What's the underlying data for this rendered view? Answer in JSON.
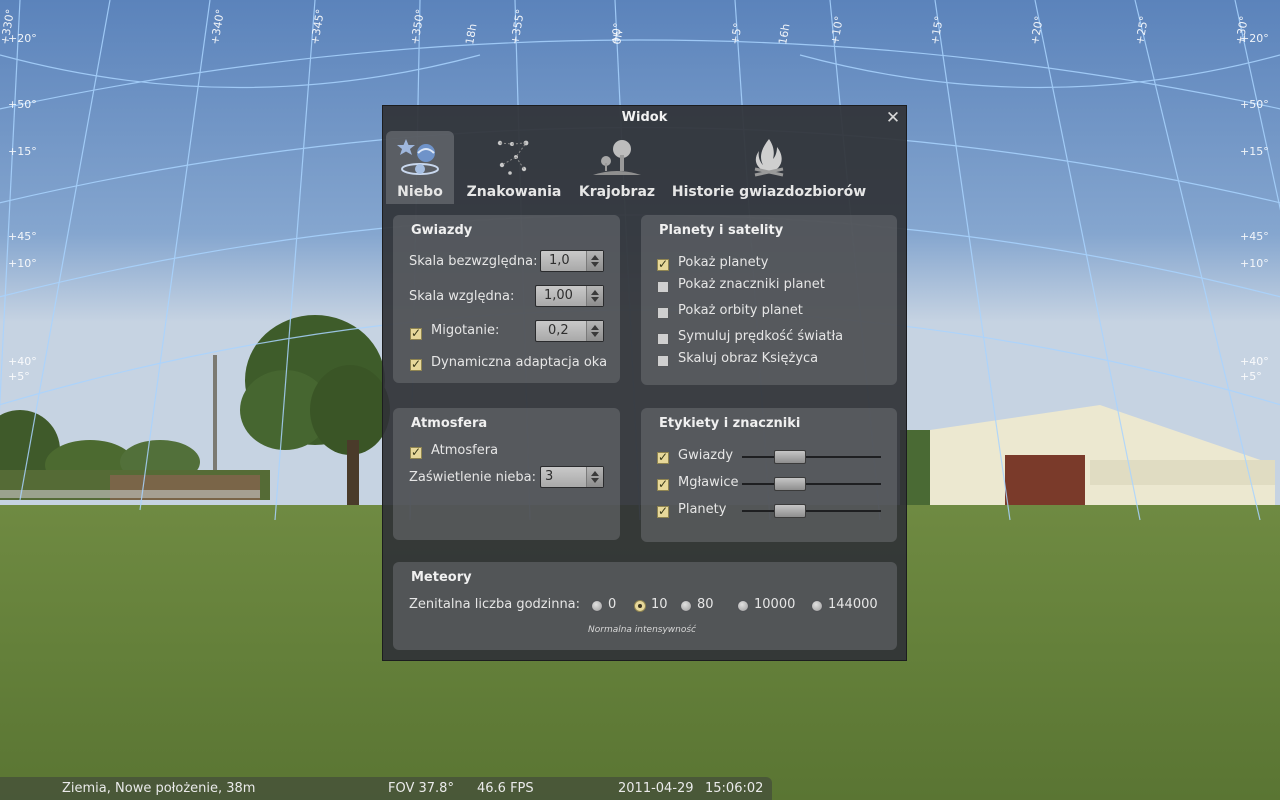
{
  "dialog": {
    "title": "Widok",
    "close_symbol": "✕",
    "tabs": [
      {
        "label": "Niebo",
        "icon": "sky-icon",
        "active": true
      },
      {
        "label": "Znakowania",
        "icon": "constellation-icon",
        "active": false
      },
      {
        "label": "Krajobraz",
        "icon": "landscape-icon",
        "active": false
      },
      {
        "label": "Historie gwiazdozbiorów",
        "icon": "campfire-icon",
        "active": false
      }
    ]
  },
  "stars": {
    "title": "Gwiazdy",
    "absolute_scale_label": "Skala bezwzględna:",
    "absolute_scale_value": "1,0",
    "relative_scale_label": "Skala względna:",
    "relative_scale_value": "1,00",
    "twinkle_label": "Migotanie:",
    "twinkle_checked": true,
    "twinkle_value": "0,2",
    "eye_adaptation_label": "Dynamiczna adaptacja oka",
    "eye_adaptation_checked": true
  },
  "planets": {
    "title": "Planety i satelity",
    "options": [
      {
        "label": "Pokaż planety",
        "checked": true
      },
      {
        "label": "Pokaż znaczniki planet",
        "checked": false
      },
      {
        "label": "Pokaż orbity planet",
        "checked": false
      },
      {
        "label": "Symuluj prędkość światła",
        "checked": false
      },
      {
        "label": "Skaluj obraz Księżyca",
        "checked": false
      }
    ]
  },
  "atmosphere": {
    "title": "Atmosfera",
    "atmosphere_label": "Atmosfera",
    "atmosphere_checked": true,
    "light_pollution_label": "Zaświetlenie nieba:",
    "light_pollution_value": "3"
  },
  "labels": {
    "title": "Etykiety i znaczniki",
    "items": [
      {
        "label": "Gwiazdy",
        "checked": true,
        "level": 0.35
      },
      {
        "label": "Mgławice",
        "checked": true,
        "level": 0.35
      },
      {
        "label": "Planety",
        "checked": true,
        "level": 0.35
      }
    ]
  },
  "meteors": {
    "title": "Meteory",
    "zhr_label": "Zenitalna liczba godzinna:",
    "options": [
      {
        "label": "0",
        "checked": false
      },
      {
        "label": "10",
        "checked": true
      },
      {
        "label": "80",
        "checked": false
      },
      {
        "label": "10000",
        "checked": false
      },
      {
        "label": "144000",
        "checked": false
      }
    ],
    "hint": "Normalna intensywność"
  },
  "status": {
    "location": "Ziemia, Nowe położenie, 38m",
    "fov": "FOV 37.8°",
    "fps": "46.6 FPS",
    "date": "2011-04-29",
    "time": "15:06:02"
  },
  "sky_grid": {
    "top_labels": [
      "+330°",
      "+340°",
      "+345°",
      "+350°",
      "18h",
      "+355°",
      "+0°",
      "0h",
      "+5°",
      "16h",
      "+10°",
      "+15°",
      "+20°",
      "+25°",
      "+30°"
    ],
    "left_labels": [
      "+20°",
      "+50°",
      "+15°",
      "+45°",
      "+10°",
      "+40°",
      "+5°"
    ],
    "right_labels": [
      "+20°",
      "+50°",
      "+15°",
      "+45°",
      "+10°",
      "+40°",
      "+5°"
    ]
  },
  "colors": {
    "checkbox_checked": "#e7d89a",
    "grid_line": "#a9d4ff",
    "sky_top": "#5e86bd",
    "grass": "#5f7a35"
  }
}
